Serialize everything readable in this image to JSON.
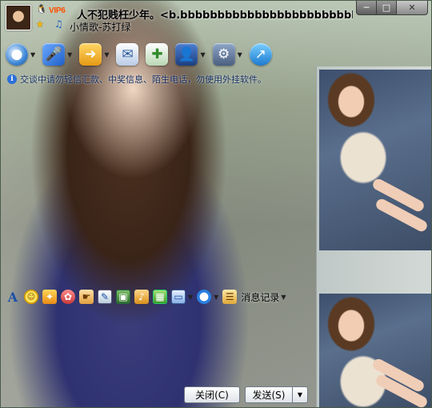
{
  "header": {
    "vip_label": "VIP6",
    "contact_name": "人不犯贱枉少年。<b.bbbbbbbbbbbbbbbbbbbbbbbbbbbbb...",
    "song": "小情歌-苏打绿"
  },
  "window_controls": {
    "minimize": "─",
    "maximize": "□",
    "close": "✕"
  },
  "security_notice": "交谈中请勿轻信汇款、中奖信息、陌生电话，勿使用外挂软件。",
  "format_toolbar": {
    "font_glyph": "A",
    "history_label": "消息记录"
  },
  "buttons": {
    "close_label": "关闭(C)",
    "send_label": "发送(S)"
  },
  "colors": {
    "accent": "#1a4fa8",
    "vip": "#ff4e00"
  }
}
